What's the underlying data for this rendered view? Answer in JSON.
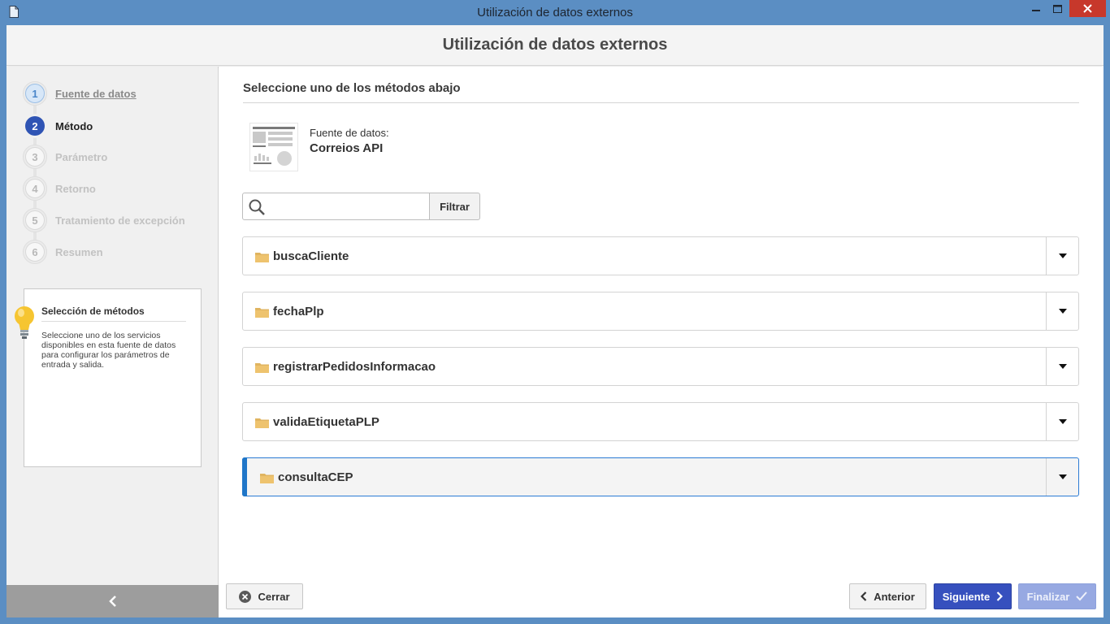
{
  "window": {
    "title": "Utilización de datos externos"
  },
  "header": {
    "title": "Utilización de datos externos"
  },
  "steps": [
    {
      "number": "1",
      "label": "Fuente de datos",
      "state": "done"
    },
    {
      "number": "2",
      "label": "Método",
      "state": "active"
    },
    {
      "number": "3",
      "label": "Parámetro",
      "state": "todo"
    },
    {
      "number": "4",
      "label": "Retorno",
      "state": "todo"
    },
    {
      "number": "5",
      "label": "Tratamiento de excepción",
      "state": "todo"
    },
    {
      "number": "6",
      "label": "Resumen",
      "state": "todo"
    }
  ],
  "tip": {
    "title": "Selección de métodos",
    "text": "Seleccione uno de los servicios disponibles en esta fuente de datos para configurar los parámetros de entrada y salida."
  },
  "main": {
    "section_title": "Seleccione uno de los métodos abajo",
    "datasource_label": "Fuente de datos:",
    "datasource_value": "Correios API",
    "search": {
      "value": "",
      "placeholder": ""
    },
    "filter_label": "Filtrar",
    "methods": [
      {
        "label": "buscaCliente",
        "selected": false
      },
      {
        "label": "fechaPlp",
        "selected": false
      },
      {
        "label": "registrarPedidosInformacao",
        "selected": false
      },
      {
        "label": "validaEtiquetaPLP",
        "selected": false
      },
      {
        "label": "consultaCEP",
        "selected": true
      }
    ]
  },
  "footer": {
    "close_label": "Cerrar",
    "prev_label": "Anterior",
    "next_label": "Siguiente",
    "finish_label": "Finalizar"
  },
  "colors": {
    "accent": "#3650be",
    "selected_bar": "#1f76c8",
    "titlebar": "#5b8ec3"
  }
}
